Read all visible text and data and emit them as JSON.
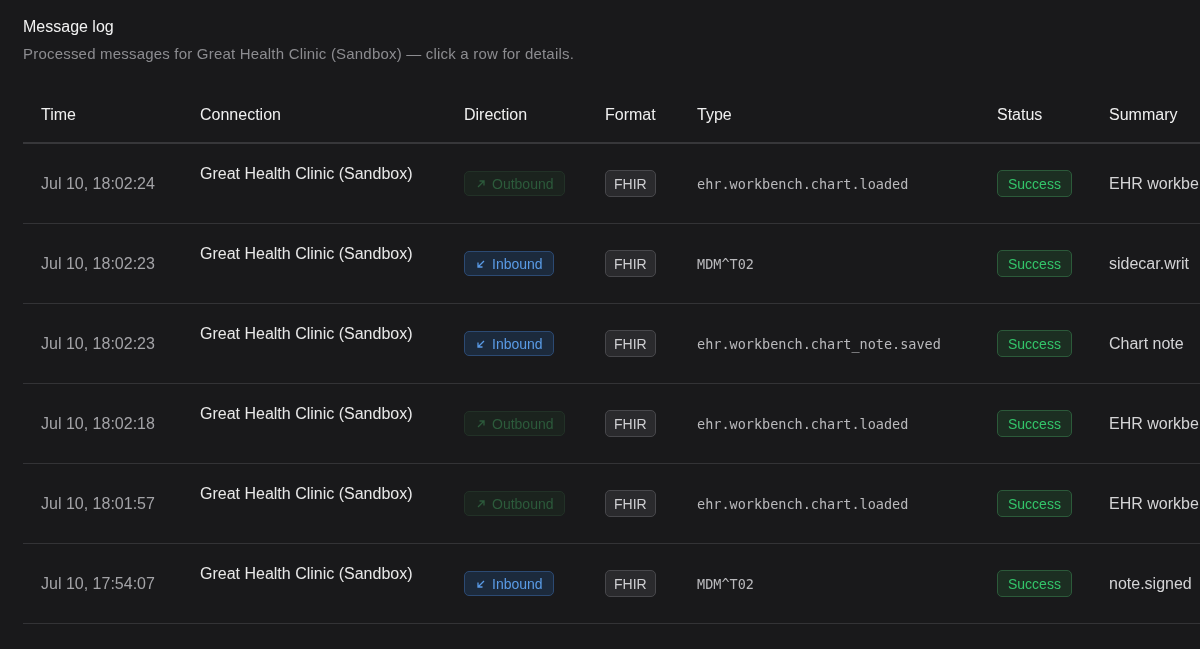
{
  "title": "Message log",
  "subtitle": "Processed messages for Great Health Clinic (Sandbox) — click a row for details.",
  "columns": [
    "Time",
    "Connection",
    "Direction",
    "Format",
    "Type",
    "Status",
    "Summary"
  ],
  "rows": [
    {
      "time": "Jul 10, 18:02:24",
      "connection": "Great Health Clinic (Sandbox)",
      "direction": {
        "label": "Outbound",
        "kind": "outbound"
      },
      "format": "FHIR",
      "type": "ehr.workbench.chart.loaded",
      "status": {
        "label": "Success",
        "kind": "success"
      },
      "summary": "EHR workbe"
    },
    {
      "time": "Jul 10, 18:02:23",
      "connection": "Great Health Clinic (Sandbox)",
      "direction": {
        "label": "Inbound",
        "kind": "inbound"
      },
      "format": "FHIR",
      "type": "MDM^T02",
      "status": {
        "label": "Success",
        "kind": "success"
      },
      "summary": "sidecar.writ"
    },
    {
      "time": "Jul 10, 18:02:23",
      "connection": "Great Health Clinic (Sandbox)",
      "direction": {
        "label": "Inbound",
        "kind": "inbound"
      },
      "format": "FHIR",
      "type": "ehr.workbench.chart_note.saved",
      "status": {
        "label": "Success",
        "kind": "success"
      },
      "summary": "Chart note"
    },
    {
      "time": "Jul 10, 18:02:18",
      "connection": "Great Health Clinic (Sandbox)",
      "direction": {
        "label": "Outbound",
        "kind": "outbound"
      },
      "format": "FHIR",
      "type": "ehr.workbench.chart.loaded",
      "status": {
        "label": "Success",
        "kind": "success"
      },
      "summary": "EHR workbe"
    },
    {
      "time": "Jul 10, 18:01:57",
      "connection": "Great Health Clinic (Sandbox)",
      "direction": {
        "label": "Outbound",
        "kind": "outbound"
      },
      "format": "FHIR",
      "type": "ehr.workbench.chart.loaded",
      "status": {
        "label": "Success",
        "kind": "success"
      },
      "summary": "EHR workbe"
    },
    {
      "time": "Jul 10, 17:54:07",
      "connection": "Great Health Clinic (Sandbox)",
      "direction": {
        "label": "Inbound",
        "kind": "inbound"
      },
      "format": "FHIR",
      "type": "MDM^T02",
      "status": {
        "label": "Success",
        "kind": "success"
      },
      "summary": "note.signed"
    }
  ]
}
